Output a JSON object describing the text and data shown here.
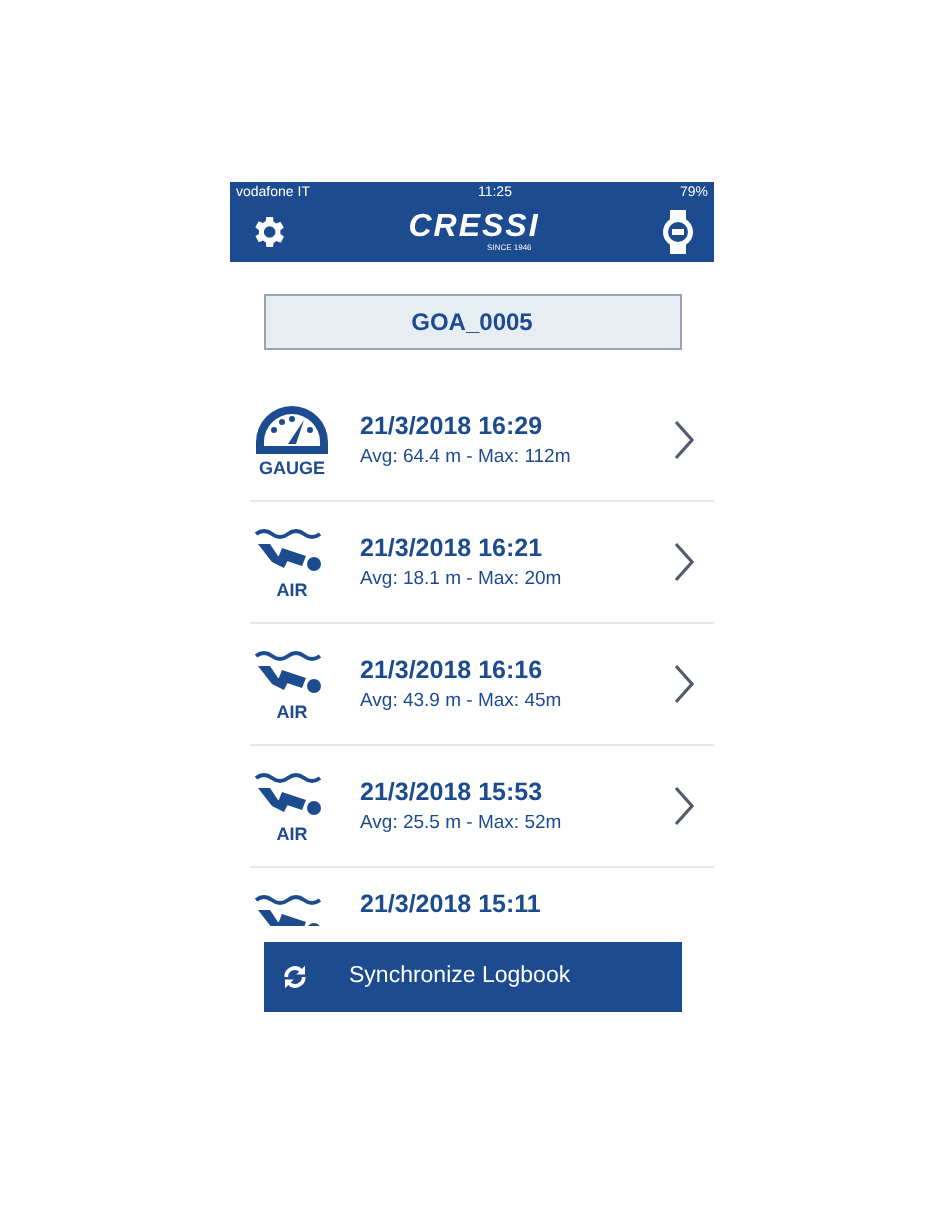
{
  "status_bar": {
    "carrier": "vodafone IT",
    "time": "11:25",
    "battery": "79%"
  },
  "nav_bar": {
    "logo": "CRESSI",
    "logo_tagline": "SINCE 1946"
  },
  "device": {
    "name": "GOA_0005"
  },
  "dives": [
    {
      "kind": "gauge",
      "mode": "GAUGE",
      "date": "21/3/2018 16:29",
      "summary": "Avg: 64.4 m - Max: 112m"
    },
    {
      "kind": "air",
      "mode": "AIR",
      "date": "21/3/2018 16:21",
      "summary": "Avg: 18.1 m - Max: 20m"
    },
    {
      "kind": "air",
      "mode": "AIR",
      "date": "21/3/2018 16:16",
      "summary": "Avg: 43.9 m - Max: 45m"
    },
    {
      "kind": "air",
      "mode": "AIR",
      "date": "21/3/2018 15:53",
      "summary": "Avg: 25.5 m - Max: 52m"
    },
    {
      "kind": "air",
      "date": "21/3/2018 15:11"
    }
  ],
  "sync_button": {
    "label": "Synchronize Logbook"
  }
}
